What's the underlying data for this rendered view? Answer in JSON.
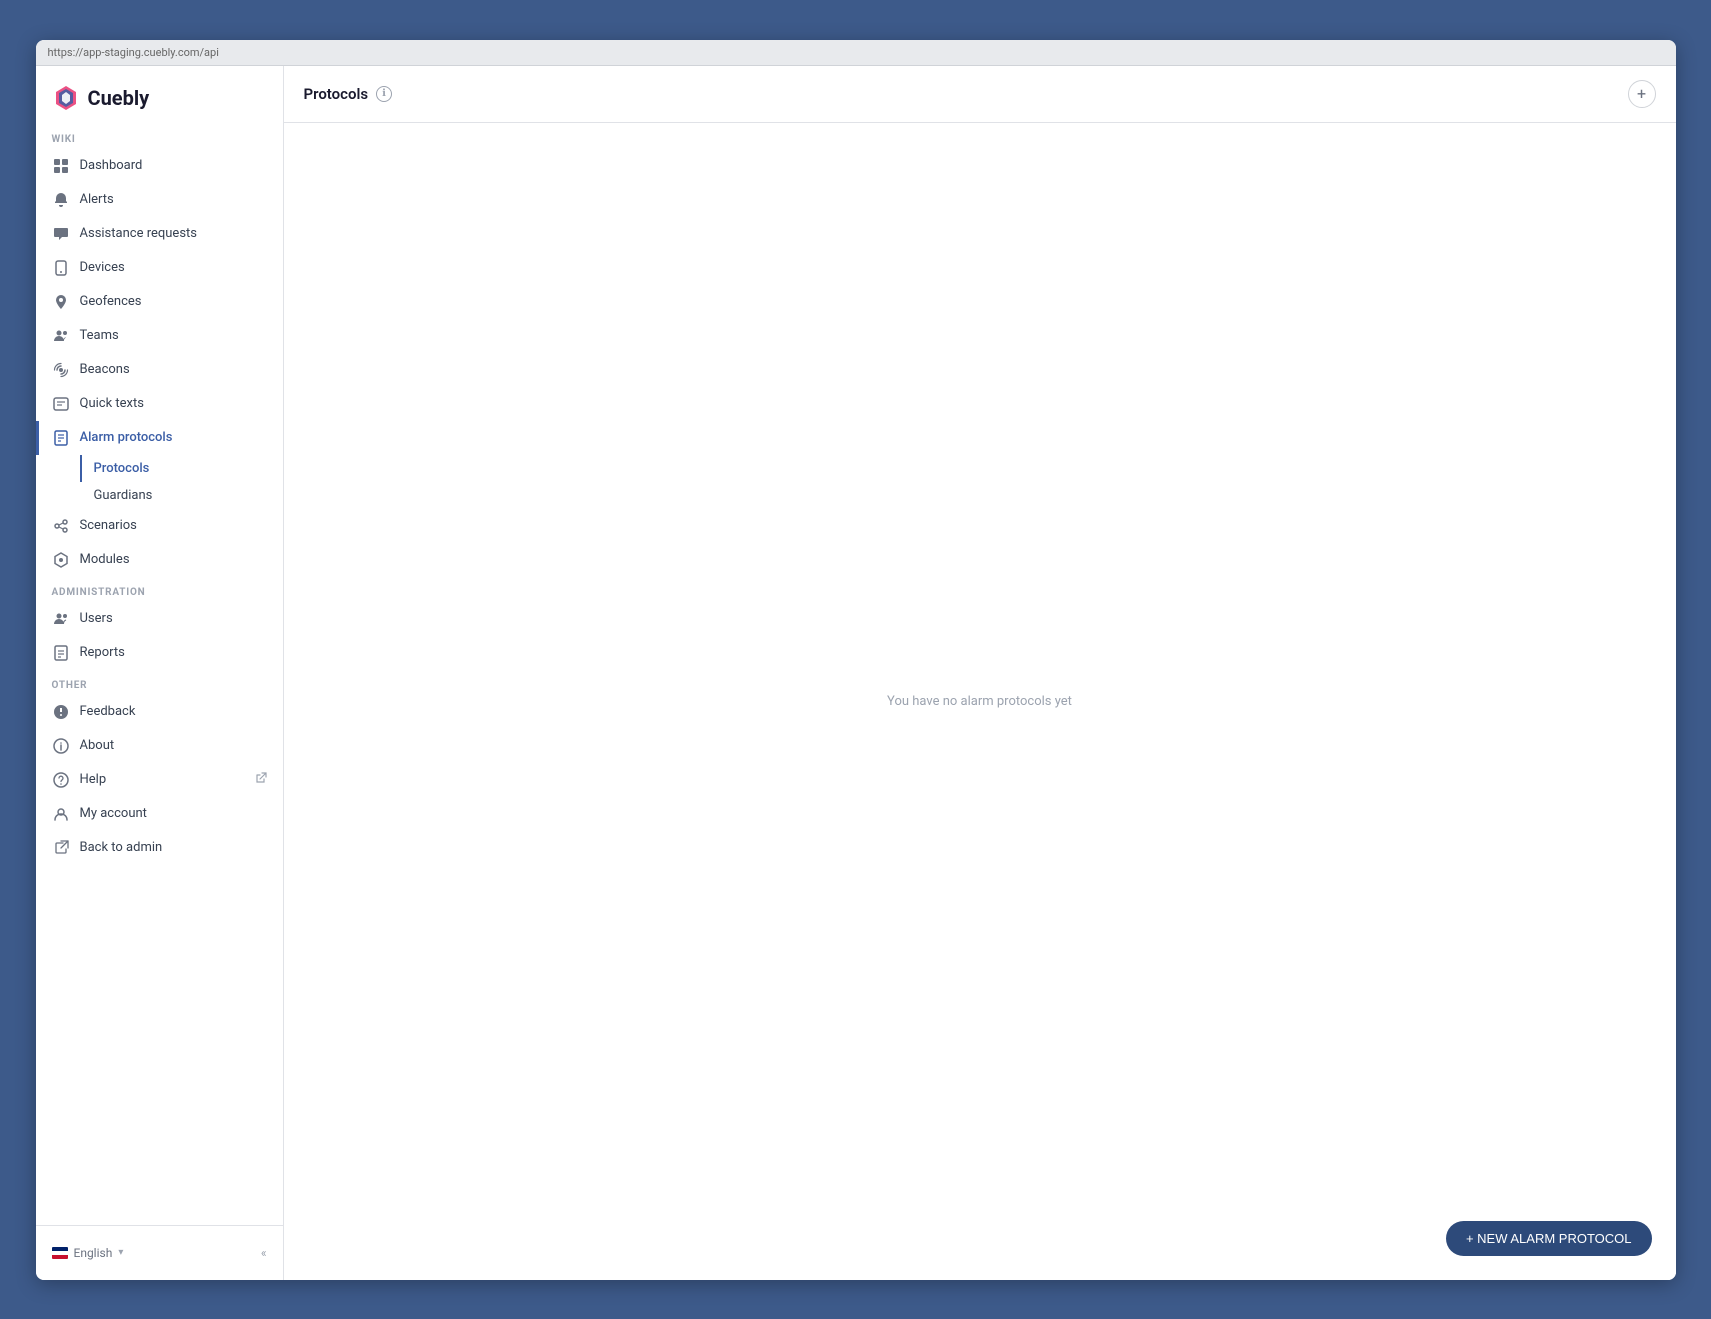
{
  "url": "https://app-staging.cuebly.com/api",
  "logo": {
    "text": "Cuebly"
  },
  "sidebar": {
    "wiki_label": "WIKI",
    "administration_label": "ADMINISTRATION",
    "other_label": "OTHER",
    "items": [
      {
        "id": "dashboard",
        "label": "Dashboard",
        "icon": "grid-icon",
        "active": false
      },
      {
        "id": "alerts",
        "label": "Alerts",
        "icon": "bell-icon",
        "active": false
      },
      {
        "id": "assistance-requests",
        "label": "Assistance requests",
        "icon": "chat-icon",
        "active": false
      },
      {
        "id": "devices",
        "label": "Devices",
        "icon": "device-icon",
        "active": false
      },
      {
        "id": "geofences",
        "label": "Geofences",
        "icon": "location-icon",
        "active": false
      },
      {
        "id": "teams",
        "label": "Teams",
        "icon": "team-icon",
        "active": false
      },
      {
        "id": "beacons",
        "label": "Beacons",
        "icon": "beacon-icon",
        "active": false
      },
      {
        "id": "quick-texts",
        "label": "Quick texts",
        "icon": "text-icon",
        "active": false
      },
      {
        "id": "alarm-protocols",
        "label": "Alarm protocols",
        "icon": "protocol-icon",
        "active": true
      }
    ],
    "sub_items": [
      {
        "id": "protocols",
        "label": "Protocols",
        "active": true
      },
      {
        "id": "guardians",
        "label": "Guardians",
        "active": false
      }
    ],
    "admin_items": [
      {
        "id": "scenarios",
        "label": "Scenarios",
        "icon": "scenario-icon"
      },
      {
        "id": "modules",
        "label": "Modules",
        "icon": "module-icon"
      },
      {
        "id": "users",
        "label": "Users",
        "icon": "users-icon"
      },
      {
        "id": "reports",
        "label": "Reports",
        "icon": "reports-icon"
      }
    ],
    "other_items": [
      {
        "id": "feedback",
        "label": "Feedback",
        "icon": "feedback-icon"
      },
      {
        "id": "about",
        "label": "About",
        "icon": "about-icon"
      },
      {
        "id": "help",
        "label": "Help",
        "icon": "help-icon",
        "external": true
      },
      {
        "id": "my-account",
        "label": "My account",
        "icon": "account-icon"
      },
      {
        "id": "back-to-admin",
        "label": "Back to admin",
        "icon": "back-icon"
      }
    ],
    "language": "English",
    "collapse_label": "«"
  },
  "header": {
    "title": "Protocols",
    "add_tooltip": "Add"
  },
  "content": {
    "empty_state_text": "You have no alarm protocols yet",
    "new_button_label": "+ NEW ALARM PROTOCOL"
  }
}
